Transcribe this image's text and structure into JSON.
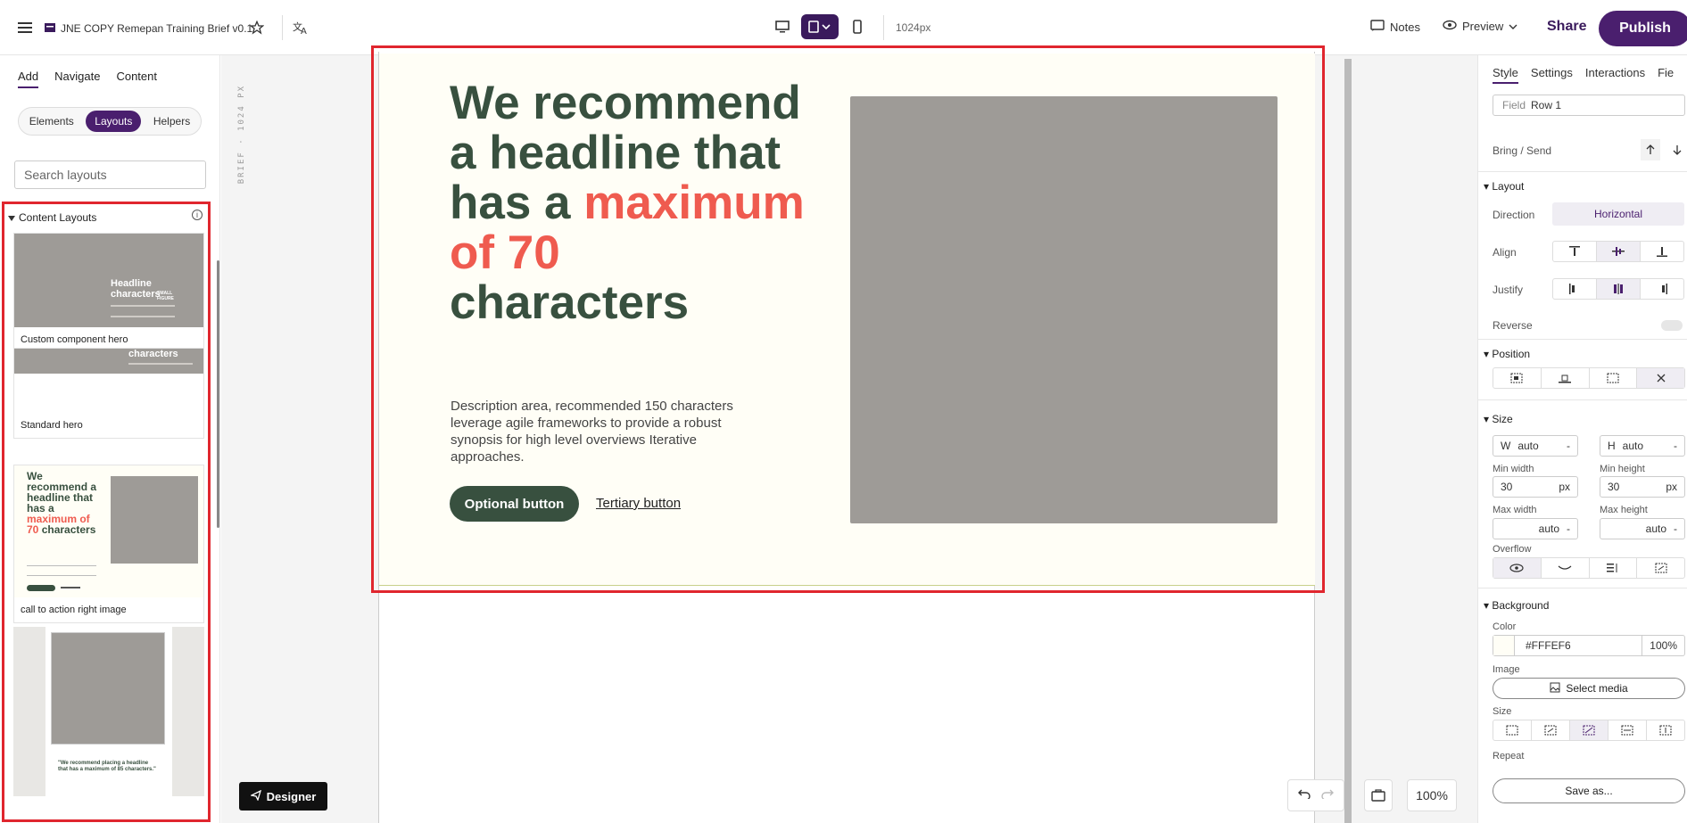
{
  "topbar": {
    "doc_title": "JNE COPY Remepan Training Brief v0.1",
    "width_label": "1024px",
    "notes_label": "Notes",
    "preview_label": "Preview",
    "share_label": "Share",
    "publish_label": "Publish"
  },
  "left": {
    "tabs": [
      "Add",
      "Navigate",
      "Content"
    ],
    "segments": [
      "Elements",
      "Layouts",
      "Helpers"
    ],
    "search_placeholder": "Search layouts",
    "section_title": "Content Layouts",
    "info_glyph": "i",
    "cards": [
      {
        "label": "Custom component hero",
        "thumb_headline": "Headline characters",
        "thumb_small": "SMALL FIGURE"
      },
      {
        "label": "Standard hero",
        "thumb_headline": "characters"
      },
      {
        "label": "call to action right image"
      },
      {
        "label": "",
        "thumb_quote": "\"We recommend placing a headline that has a maximum of 85 characters.\""
      }
    ]
  },
  "canvas": {
    "brief_label": "BRIEF · 1024 PX",
    "headline_pre": "We recommend a headline that has a ",
    "headline_accent": "maximum of 70",
    "headline_post": " characters",
    "description": "Description area, recommended 150 characters leverage agile frameworks to provide a robust synopsis for high level overviews Iterative approaches.",
    "optional_button": "Optional button",
    "tertiary_button": "Tertiary button",
    "designer_label": "Designer",
    "zoom": "100%"
  },
  "right": {
    "tabs": [
      "Style",
      "Settings",
      "Interactions",
      "Fie"
    ],
    "field_label": "Field",
    "field_value": "Row 1",
    "bring_send": "Bring / Send",
    "layout_title": "Layout",
    "direction_label": "Direction",
    "direction_value": "Horizontal",
    "align_label": "Align",
    "justify_label": "Justify",
    "reverse_label": "Reverse",
    "position_title": "Position",
    "size_title": "Size",
    "w_label": "W",
    "w_value": "auto",
    "h_label": "H",
    "h_value": "auto",
    "min_width_label": "Min width",
    "min_width_value": "30",
    "min_height_label": "Min height",
    "min_height_value": "30",
    "unit_px": "px",
    "max_width_label": "Max width",
    "max_width_value": "auto",
    "max_height_label": "Max height",
    "max_height_value": "auto",
    "dash": "-",
    "overflow_label": "Overflow",
    "background_title": "Background",
    "color_label": "Color",
    "color_value": "#FFFEF6",
    "color_opacity": "100%",
    "image_label": "Image",
    "select_media": "Select media",
    "bg_size_label": "Size",
    "repeat_label": "Repeat",
    "save_as": "Save as..."
  },
  "colors": {
    "brand": "#4a1f6e",
    "hero_bg": "#fffef6",
    "headline_green": "#38503f",
    "accent_red": "#ef5b4f",
    "placeholder_grey": "#9e9b97",
    "highlight_outline": "#e0262e"
  }
}
